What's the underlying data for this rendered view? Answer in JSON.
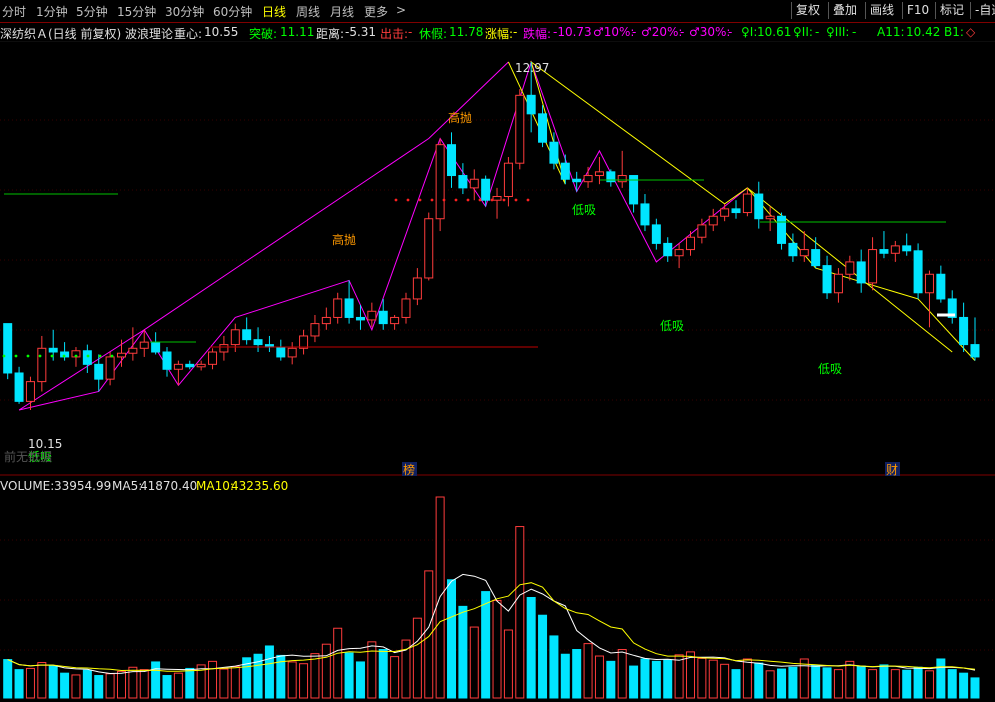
{
  "toolbar": {
    "tabs": [
      "分时",
      "1分钟",
      "5分钟",
      "15分钟",
      "30分钟",
      "60分钟",
      "日线",
      "周线",
      "月线",
      "更多"
    ],
    "active_tab": "日线",
    "more_arrow": ">",
    "buttons": [
      "复权",
      "叠加",
      "画线",
      "F10",
      "标记",
      "-自选"
    ]
  },
  "infobar": {
    "stock": "深纺织Ａ(日线 前复权) 波浪理论",
    "center_label": "重心:",
    "center_value": "10.55",
    "break_label": "突破:",
    "break_value": "11.11",
    "dist_label": "距离:",
    "dist_value": "-5.31",
    "out_label": "出击:",
    "out_value": "-",
    "rest_label": "休假:",
    "rest_value": "11.78",
    "rise_label": "涨幅:",
    "rise_value": "-",
    "fall_label": "跌幅:",
    "fall_value": "-10.73",
    "m10": "♂10%:",
    "m10_value": "-",
    "m20": "♂20%:",
    "m20_value": "-",
    "m30": "♂30%:",
    "m30_value": "-",
    "f1": "♀I:",
    "f1_value": "10.61",
    "f2": "♀II:",
    "f2_value": "-",
    "f3": "♀III:",
    "f3_value": "-",
    "a11": "A11:",
    "a11_value": "10.42",
    "b1": "B1:",
    "diamond": "◇"
  },
  "volume": {
    "label": "VOLUME:",
    "value": "33954.99",
    "ma5_label": "MA5:",
    "ma5_value": "41870.40",
    "ma10_label": "MA10:",
    "ma10_value": "43235.60"
  },
  "annotations": {
    "peak_price": "12.97",
    "low_price": "10.15",
    "high_throw": "高抛",
    "low_buy": "低吸",
    "no_data": "前无数据",
    "bang": "榜",
    "cai": "财"
  },
  "colors": {
    "up": "#ff3c3c",
    "down": "#00e5ff",
    "ma5": "#ffffff",
    "ma10": "#ffff00",
    "wave": "#ff00ff",
    "signal_yellow": "#ffff00",
    "green": "#00ff00"
  },
  "chart_data": {
    "type": "candlestick",
    "candles": [
      [
        10.85,
        10.85,
        10.4,
        10.45
      ],
      [
        10.45,
        10.5,
        10.2,
        10.22
      ],
      [
        10.22,
        10.42,
        10.15,
        10.38
      ],
      [
        10.38,
        10.75,
        10.3,
        10.65
      ],
      [
        10.65,
        10.8,
        10.55,
        10.62
      ],
      [
        10.62,
        10.7,
        10.55,
        10.58
      ],
      [
        10.58,
        10.66,
        10.5,
        10.63
      ],
      [
        10.63,
        10.68,
        10.45,
        10.52
      ],
      [
        10.52,
        10.6,
        10.3,
        10.4
      ],
      [
        10.4,
        10.62,
        10.35,
        10.58
      ],
      [
        10.58,
        10.72,
        10.5,
        10.61
      ],
      [
        10.61,
        10.82,
        10.55,
        10.65
      ],
      [
        10.65,
        10.8,
        10.58,
        10.7
      ],
      [
        10.7,
        10.78,
        10.6,
        10.62
      ],
      [
        10.62,
        10.66,
        10.42,
        10.48
      ],
      [
        10.48,
        10.55,
        10.35,
        10.52
      ],
      [
        10.52,
        10.55,
        10.48,
        10.5
      ],
      [
        10.5,
        10.55,
        10.47,
        10.52
      ],
      [
        10.52,
        10.65,
        10.48,
        10.62
      ],
      [
        10.62,
        10.75,
        10.55,
        10.68
      ],
      [
        10.68,
        10.85,
        10.62,
        10.8
      ],
      [
        10.8,
        10.9,
        10.68,
        10.72
      ],
      [
        10.72,
        10.82,
        10.62,
        10.68
      ],
      [
        10.68,
        10.75,
        10.62,
        10.66
      ],
      [
        10.66,
        10.72,
        10.55,
        10.58
      ],
      [
        10.58,
        10.7,
        10.52,
        10.65
      ],
      [
        10.65,
        10.8,
        10.6,
        10.75
      ],
      [
        10.75,
        10.92,
        10.7,
        10.85
      ],
      [
        10.85,
        10.98,
        10.8,
        10.9
      ],
      [
        10.9,
        11.1,
        10.85,
        11.05
      ],
      [
        11.05,
        11.2,
        10.85,
        10.9
      ],
      [
        10.9,
        11.0,
        10.8,
        10.88
      ],
      [
        10.88,
        11.02,
        10.82,
        10.95
      ],
      [
        10.95,
        11.05,
        10.8,
        10.85
      ],
      [
        10.85,
        10.92,
        10.8,
        10.9
      ],
      [
        10.9,
        11.1,
        10.85,
        11.05
      ],
      [
        11.05,
        11.3,
        11.0,
        11.22
      ],
      [
        11.22,
        11.75,
        11.2,
        11.7
      ],
      [
        11.7,
        12.35,
        11.6,
        12.3
      ],
      [
        12.3,
        12.4,
        11.95,
        12.05
      ],
      [
        12.05,
        12.15,
        11.9,
        11.95
      ],
      [
        11.95,
        12.1,
        11.85,
        12.02
      ],
      [
        12.02,
        12.05,
        11.8,
        11.85
      ],
      [
        11.85,
        11.95,
        11.7,
        11.88
      ],
      [
        11.88,
        12.2,
        11.8,
        12.15
      ],
      [
        12.15,
        12.75,
        12.1,
        12.7
      ],
      [
        12.7,
        12.97,
        12.4,
        12.55
      ],
      [
        12.55,
        12.62,
        12.28,
        12.32
      ],
      [
        12.32,
        12.4,
        12.1,
        12.15
      ],
      [
        12.15,
        12.22,
        11.98,
        12.02
      ],
      [
        12.02,
        12.08,
        11.92,
        12.0
      ],
      [
        12.0,
        12.12,
        11.95,
        12.05
      ],
      [
        12.05,
        12.2,
        11.98,
        12.08
      ],
      [
        12.08,
        12.1,
        11.96,
        12.0
      ],
      [
        12.0,
        12.25,
        11.95,
        12.05
      ],
      [
        12.05,
        12.05,
        11.75,
        11.82
      ],
      [
        11.82,
        11.9,
        11.6,
        11.65
      ],
      [
        11.65,
        11.7,
        11.45,
        11.5
      ],
      [
        11.5,
        11.55,
        11.35,
        11.4
      ],
      [
        11.4,
        11.5,
        11.3,
        11.45
      ],
      [
        11.45,
        11.6,
        11.4,
        11.55
      ],
      [
        11.55,
        11.7,
        11.5,
        11.65
      ],
      [
        11.65,
        11.78,
        11.6,
        11.72
      ],
      [
        11.72,
        11.82,
        11.68,
        11.78
      ],
      [
        11.78,
        11.85,
        11.7,
        11.75
      ],
      [
        11.75,
        11.95,
        11.72,
        11.9
      ],
      [
        11.9,
        12.0,
        11.62,
        11.7
      ],
      [
        11.7,
        11.8,
        11.6,
        11.72
      ],
      [
        11.72,
        11.75,
        11.45,
        11.5
      ],
      [
        11.5,
        11.58,
        11.35,
        11.4
      ],
      [
        11.4,
        11.6,
        11.35,
        11.45
      ],
      [
        11.45,
        11.55,
        11.3,
        11.32
      ],
      [
        11.32,
        11.4,
        11.05,
        11.1
      ],
      [
        11.1,
        11.3,
        11.02,
        11.25
      ],
      [
        11.25,
        11.4,
        11.2,
        11.35
      ],
      [
        11.35,
        11.45,
        11.1,
        11.18
      ],
      [
        11.18,
        11.55,
        11.12,
        11.45
      ],
      [
        11.45,
        11.6,
        11.38,
        11.42
      ],
      [
        11.42,
        11.52,
        11.35,
        11.48
      ],
      [
        11.48,
        11.58,
        11.4,
        11.44
      ],
      [
        11.44,
        11.5,
        11.05,
        11.1
      ],
      [
        11.1,
        11.28,
        10.82,
        11.25
      ],
      [
        11.25,
        11.32,
        11.02,
        11.05
      ],
      [
        11.05,
        11.12,
        10.85,
        10.9
      ],
      [
        10.9,
        11.02,
        10.62,
        10.68
      ],
      [
        10.68,
        10.9,
        10.55,
        10.58
      ]
    ],
    "volume": [
      6500,
      4800,
      5000,
      6000,
      5500,
      4200,
      3900,
      4700,
      3800,
      4100,
      4500,
      5200,
      4800,
      6100,
      3800,
      4200,
      5000,
      5600,
      6200,
      4900,
      5300,
      6800,
      7400,
      8800,
      7200,
      6100,
      5800,
      7500,
      9100,
      11800,
      7600,
      6100,
      9500,
      8200,
      7000,
      9800,
      13500,
      21500,
      34000,
      20000,
      15500,
      12000,
      18000,
      16500,
      11500,
      29000,
      17000,
      14000,
      10500,
      7400,
      8200,
      9200,
      7100,
      6200,
      8200,
      5400,
      6600,
      6200,
      6400,
      7300,
      7800,
      6700,
      6400,
      5700,
      4800,
      6600,
      5900,
      4600,
      4900,
      5200,
      6600,
      5500,
      5100,
      4800,
      6200,
      5400,
      4800,
      5600,
      4800,
      4700,
      5200,
      4600,
      6600,
      4800,
      4200,
      3400
    ]
  }
}
